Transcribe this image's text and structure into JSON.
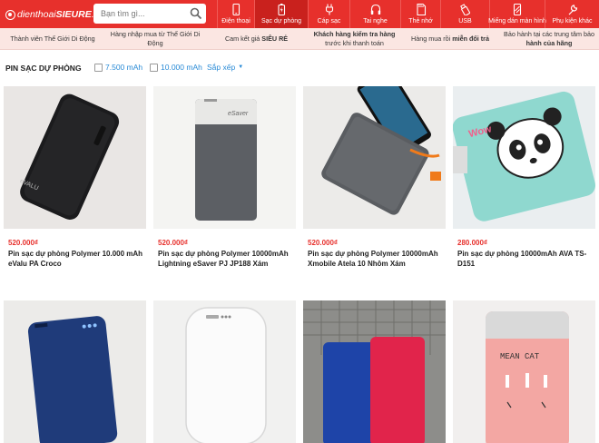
{
  "header": {
    "logo_prefix": "dienthoai",
    "logo_bold": "SIEURE",
    "logo_suffix": "....",
    "search_placeholder": "Bạn tìm gì...",
    "categories": [
      {
        "label": "Điện thoại",
        "icon": "phone-icon"
      },
      {
        "label": "Sạc dự phòng",
        "icon": "battery-icon",
        "active": true
      },
      {
        "label": "Cáp sạc",
        "icon": "cable-icon"
      },
      {
        "label": "Tai nghe",
        "icon": "headphone-icon"
      },
      {
        "label": "Thẻ nhớ",
        "icon": "memory-card-icon"
      },
      {
        "label": "USB",
        "icon": "usb-icon"
      },
      {
        "label": "Miếng dán màn hình",
        "icon": "screen-protector-icon"
      },
      {
        "label": "Phụ kiện khác",
        "icon": "accessory-icon"
      }
    ]
  },
  "commitments": [
    {
      "line1": "Thành viên Thế Giới Di Động",
      "line2": ""
    },
    {
      "line1": "Hàng nhập mua từ Thế Giới Di",
      "line2": "Động"
    },
    {
      "line1_pre": "Cam kết giá ",
      "line1_bold": "SIÊU RẺ"
    },
    {
      "line1_bold": "Khách hàng kiểm tra hàng",
      "line2": "trước khi thanh toán"
    },
    {
      "line1_pre": "Hàng mua rồi ",
      "line1_bold": "miễn đổi trả"
    },
    {
      "line1": "Bảo hành tại các trung tâm bảo",
      "line2_bold": "hành của hãng"
    }
  ],
  "filter": {
    "title": "PIN SẠC DỰ PHÒNG",
    "options": [
      "7.500 mAh",
      "10.000 mAh"
    ],
    "sort_label": "Sắp xếp",
    "caret": "▼"
  },
  "products": [
    {
      "price": "520.000₫",
      "name": "Pin sạc dự phòng Polymer 10.000 mAh eValu PA Croco"
    },
    {
      "price": "520.000₫",
      "name": "Pin sạc dự phòng Polymer 10000mAh Lightning eSaver PJ JP188 Xám"
    },
    {
      "price": "520.000₫",
      "name": "Pin sạc dự phòng Polymer 10000mAh Xmobile Atela 10 Nhôm Xám"
    },
    {
      "price": "280.000₫",
      "name": "Pin sạc dự phòng 10000mAh AVA TS-D151"
    },
    {
      "price": "",
      "name": ""
    },
    {
      "price": "",
      "name": ""
    },
    {
      "price": "",
      "name": ""
    },
    {
      "price": "",
      "name": ""
    }
  ],
  "image_labels": {
    "evalu": "eVALU",
    "esaver": "eSaver",
    "mean_cat": "MEAN CAT",
    "wow": "Wow"
  },
  "colors": {
    "brand_red": "#e7302c",
    "link_blue": "#288ad6",
    "commit_bg": "#fbe6e2"
  }
}
